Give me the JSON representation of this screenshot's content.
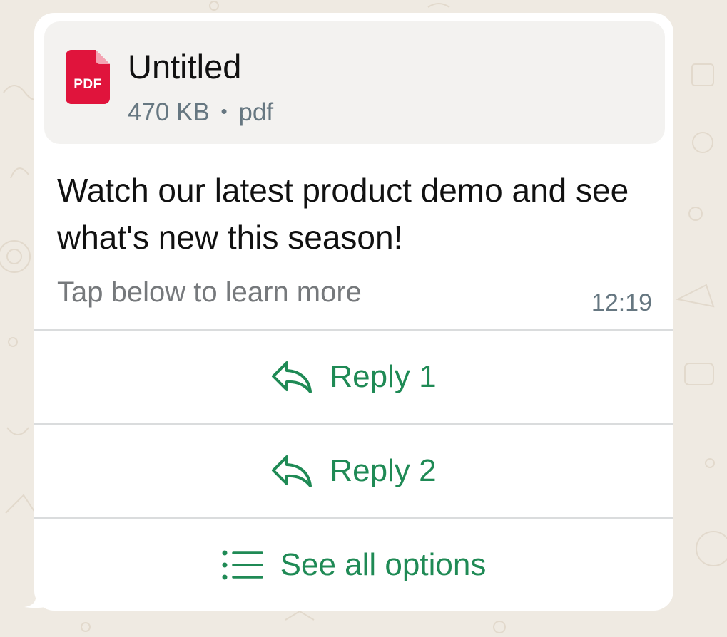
{
  "message": {
    "document": {
      "title": "Untitled",
      "size": "470 KB",
      "separator": "•",
      "ext": "pdf",
      "icon_label": "PDF",
      "icon": "pdf-file-icon"
    },
    "body": "Watch our latest product demo and see what's new this season!",
    "footer": "Tap below to learn more",
    "time": "12:19"
  },
  "buttons": [
    {
      "label": "Reply 1",
      "icon": "reply-icon"
    },
    {
      "label": "Reply 2",
      "icon": "reply-icon"
    },
    {
      "label": "See all options",
      "icon": "list-icon"
    }
  ],
  "colors": {
    "background": "#efeae2",
    "bubble": "#ffffff",
    "doc_card": "#f3f2f0",
    "pdf_red": "#e0143c",
    "accent_green": "#1f8a55",
    "meta_gray": "#667781"
  }
}
